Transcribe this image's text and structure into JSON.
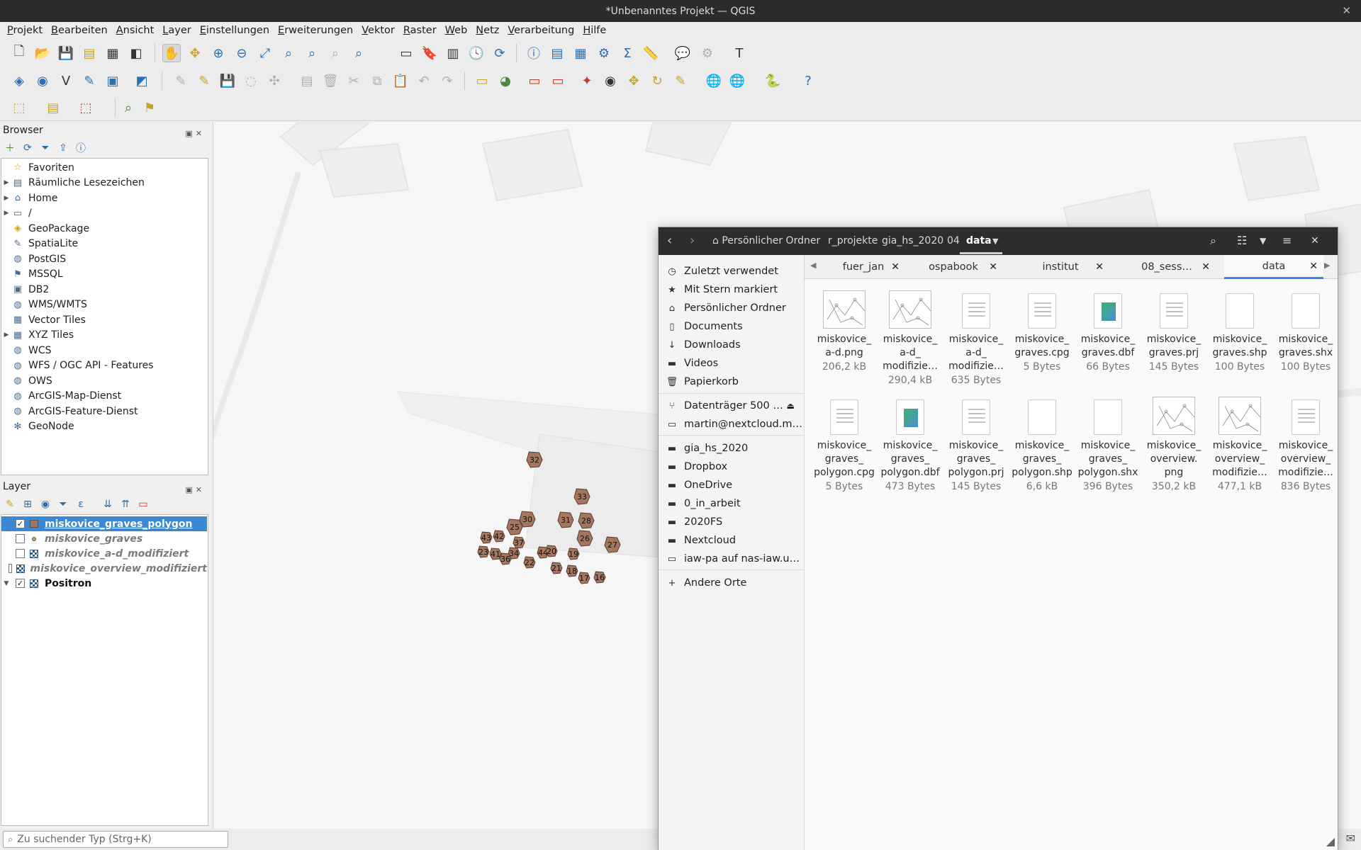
{
  "window_title": "*Unbenanntes Projekt — QGIS",
  "menu": [
    "Projekt",
    "Bearbeiten",
    "Ansicht",
    "Layer",
    "Einstellungen",
    "Erweiterungen",
    "Vektor",
    "Raster",
    "Web",
    "Netz",
    "Verarbeitung",
    "Hilfe"
  ],
  "browser": {
    "title": "Browser",
    "items": [
      {
        "label": "Favoriten",
        "icon": "star-icon",
        "expandable": false
      },
      {
        "label": "Räumliche Lesezeichen",
        "icon": "bookmark-icon",
        "expandable": true
      },
      {
        "label": "Home",
        "icon": "home-folder-icon",
        "expandable": true
      },
      {
        "label": "/",
        "icon": "folder-icon",
        "expandable": true
      },
      {
        "label": "GeoPackage",
        "icon": "geopackage-icon",
        "expandable": false
      },
      {
        "label": "SpatiaLite",
        "icon": "spatialite-icon",
        "expandable": false
      },
      {
        "label": "PostGIS",
        "icon": "postgis-icon",
        "expandable": false
      },
      {
        "label": "MSSQL",
        "icon": "mssql-icon",
        "expandable": false
      },
      {
        "label": "DB2",
        "icon": "db2-icon",
        "expandable": false
      },
      {
        "label": "WMS/WMTS",
        "icon": "globe-icon",
        "expandable": false
      },
      {
        "label": "Vector Tiles",
        "icon": "grid-icon",
        "expandable": false
      },
      {
        "label": "XYZ Tiles",
        "icon": "tiles-icon",
        "expandable": true
      },
      {
        "label": "WCS",
        "icon": "globe-icon",
        "expandable": false
      },
      {
        "label": "WFS / OGC API - Features",
        "icon": "globe-icon",
        "expandable": false
      },
      {
        "label": "OWS",
        "icon": "globe-icon",
        "expandable": false
      },
      {
        "label": "ArcGIS-Map-Dienst",
        "icon": "globe-icon",
        "expandable": false
      },
      {
        "label": "ArcGIS-Feature-Dienst",
        "icon": "globe-icon",
        "expandable": false
      },
      {
        "label": "GeoNode",
        "icon": "geonode-icon",
        "expandable": false
      }
    ]
  },
  "layers": {
    "title": "Layer",
    "items": [
      {
        "label": "miskovice_graves_polygon",
        "checked": true,
        "symbol": "polygon-fill",
        "active": true
      },
      {
        "label": "miskovice_graves",
        "checked": false,
        "symbol": "point"
      },
      {
        "label": "miskovice_a-d_modifiziert",
        "checked": false,
        "symbol": "raster"
      },
      {
        "label": "miskovice_overview_modifiziert",
        "checked": false,
        "symbol": "raster"
      },
      {
        "label": "Positron",
        "checked": true,
        "symbol": "raster",
        "expanded": true
      }
    ]
  },
  "locator_placeholder": "Zu suchender Typ (Strg+K)",
  "map": {
    "background": "#f6f6f6",
    "grave_color": "#a5765f",
    "grave_labels": [
      "32",
      "33",
      "30",
      "31",
      "28",
      "25",
      "26",
      "27",
      "43",
      "42",
      "37",
      "23",
      "41",
      "34",
      "36",
      "44",
      "20",
      "19",
      "22",
      "21",
      "18",
      "17",
      "16"
    ]
  },
  "file_manager": {
    "breadcrumb": [
      "Persönlicher Ordner",
      "r_projekte",
      "gia_hs_2020",
      "04",
      "data"
    ],
    "sidebar": [
      {
        "label": "Zuletzt verwendet",
        "icon": "clock-icon"
      },
      {
        "label": "Mit Stern markiert",
        "icon": "star-icon"
      },
      {
        "label": "Persönlicher Ordner",
        "icon": "home-icon"
      },
      {
        "label": "Documents",
        "icon": "document-icon"
      },
      {
        "label": "Downloads",
        "icon": "download-icon"
      },
      {
        "label": "Videos",
        "icon": "video-icon"
      },
      {
        "label": "Papierkorb",
        "icon": "trash-icon"
      },
      {
        "label": "Datenträger 500 …",
        "icon": "usb-icon"
      },
      {
        "label": "martin@nextcloud.m…",
        "icon": "network-icon"
      },
      {
        "label": "gia_hs_2020",
        "icon": "folder-icon"
      },
      {
        "label": "Dropbox",
        "icon": "folder-icon"
      },
      {
        "label": "OneDrive",
        "icon": "folder-icon"
      },
      {
        "label": "0_in_arbeit",
        "icon": "folder-icon"
      },
      {
        "label": "2020FS",
        "icon": "folder-icon"
      },
      {
        "label": "Nextcloud",
        "icon": "folder-icon"
      },
      {
        "label": "iaw-pa auf nas-iaw.u…",
        "icon": "network-icon"
      },
      {
        "label": "Andere Orte",
        "icon": "plus-icon"
      }
    ],
    "tabs": [
      {
        "label": "fuer_jan",
        "active": false
      },
      {
        "label": "ospabook",
        "active": false
      },
      {
        "label": "institut",
        "active": false
      },
      {
        "label": "08_sess…",
        "active": false
      },
      {
        "label": "data",
        "active": true
      }
    ],
    "files": [
      {
        "name": "miskovice_\na-d.png",
        "size": "206,2 kB",
        "kind": "image"
      },
      {
        "name": "miskovice_\na-d_\nmodifizie…",
        "size": "290,4 kB",
        "kind": "image"
      },
      {
        "name": "miskovice_\na-d_\nmodifizie…",
        "size": "635 Bytes",
        "kind": "text"
      },
      {
        "name": "miskovice_\ngraves.cpg",
        "size": "5 Bytes",
        "kind": "text"
      },
      {
        "name": "miskovice_\ngraves.dbf",
        "size": "66 Bytes",
        "kind": "sheet"
      },
      {
        "name": "miskovice_\ngraves.prj",
        "size": "145 Bytes",
        "kind": "text"
      },
      {
        "name": "miskovice_\ngraves.shp",
        "size": "100 Bytes",
        "kind": "blank"
      },
      {
        "name": "miskovice_\ngraves.shx",
        "size": "100 Bytes",
        "kind": "blank"
      },
      {
        "name": "miskovice_\ngraves_\npolygon.cpg",
        "size": "5 Bytes",
        "kind": "text"
      },
      {
        "name": "miskovice_\ngraves_\npolygon.dbf",
        "size": "473 Bytes",
        "kind": "sheet"
      },
      {
        "name": "miskovice_\ngraves_\npolygon.prj",
        "size": "145 Bytes",
        "kind": "text"
      },
      {
        "name": "miskovice_\ngraves_\npolygon.shp",
        "size": "6,6 kB",
        "kind": "blank"
      },
      {
        "name": "miskovice_\ngraves_\npolygon.shx",
        "size": "396 Bytes",
        "kind": "blank"
      },
      {
        "name": "miskovice_\noverview.\npng",
        "size": "350,2 kB",
        "kind": "image"
      },
      {
        "name": "miskovice_\noverview_\nmodifizie…",
        "size": "477,1 kB",
        "kind": "image"
      },
      {
        "name": "miskovice_\noverview_\nmodifizie…",
        "size": "836 Bytes",
        "kind": "text"
      }
    ]
  }
}
